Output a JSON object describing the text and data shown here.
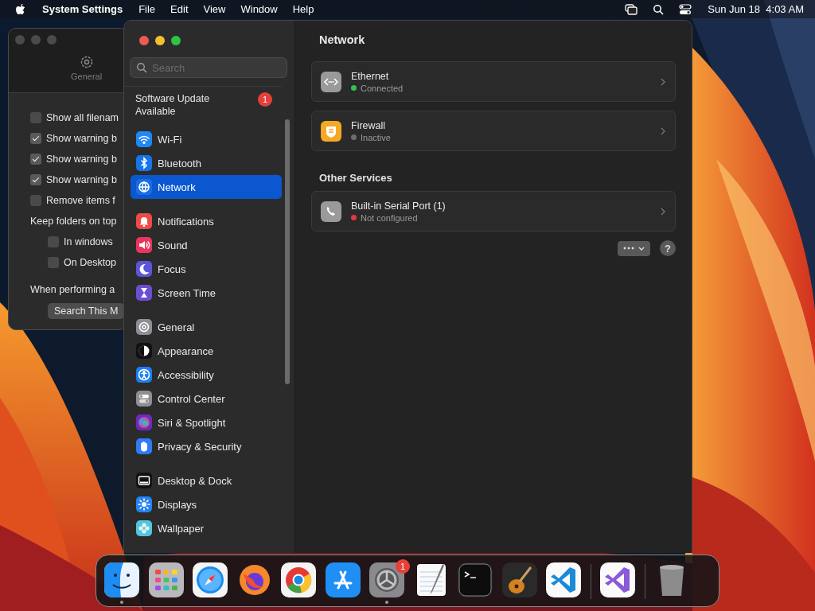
{
  "menu_bar": {
    "app_name": "System Settings",
    "menus": [
      "File",
      "Edit",
      "View",
      "Window",
      "Help"
    ],
    "clock": "Sun Jun 18  4:03 AM"
  },
  "finder_settings_window": {
    "toolbar_tab": "General",
    "options": [
      {
        "kind": "checkbox",
        "label": "Show all filenam",
        "checked": false
      },
      {
        "kind": "checkbox",
        "label": "Show warning b",
        "checked": true
      },
      {
        "kind": "checkbox",
        "label": "Show warning b",
        "checked": true
      },
      {
        "kind": "checkbox",
        "label": "Show warning b",
        "checked": true
      },
      {
        "kind": "checkbox",
        "label": "Remove items f",
        "checked": false
      },
      {
        "kind": "heading",
        "label": "Keep folders on top",
        "children": [
          {
            "kind": "checkbox",
            "label": "In windows",
            "checked": false
          },
          {
            "kind": "checkbox",
            "label": "On Desktop",
            "checked": false
          }
        ]
      },
      {
        "kind": "heading",
        "label": "When performing a"
      }
    ],
    "button": "Search This M"
  },
  "settings_window": {
    "search": {
      "placeholder": "Search"
    },
    "update_notice": {
      "text": "Software Update Available",
      "badge": "1"
    },
    "sidebar_groups": [
      [
        {
          "label": "Wi-Fi",
          "color": "#1e88f5",
          "selected": false
        },
        {
          "label": "Bluetooth",
          "color": "#1476ea",
          "selected": false
        },
        {
          "label": "Network",
          "color": "#1a6fe0",
          "selected": true
        }
      ],
      [
        {
          "label": "Notifications",
          "color": "#ee4a47",
          "selected": false
        },
        {
          "label": "Sound",
          "color": "#e8365d",
          "selected": false
        },
        {
          "label": "Focus",
          "color": "#5b55d8",
          "selected": false
        },
        {
          "label": "Screen Time",
          "color": "#6a4fd3",
          "selected": false
        }
      ],
      [
        {
          "label": "General",
          "color": "#8e8e93",
          "selected": false
        },
        {
          "label": "Appearance",
          "color": "#111111",
          "selected": false
        },
        {
          "label": "Accessibility",
          "color": "#1b7ef0",
          "selected": false
        },
        {
          "label": "Control Center",
          "color": "#8e8e93",
          "selected": false
        },
        {
          "label": "Siri & Spotlight",
          "color": "#6a2dbb",
          "selected": false
        },
        {
          "label": "Privacy & Security",
          "color": "#2f7cf6",
          "selected": false
        }
      ],
      [
        {
          "label": "Desktop & Dock",
          "color": "#111111",
          "selected": false
        },
        {
          "label": "Displays",
          "color": "#2483f0",
          "selected": false
        },
        {
          "label": "Wallpaper",
          "color": "#4fc7dc",
          "selected": false
        }
      ]
    ],
    "title": "Network",
    "services": [
      {
        "name": "Ethernet",
        "status": "Connected",
        "color": "#30c24a"
      },
      {
        "name": "Firewall",
        "status": "Inactive",
        "color": "#6e6e6e"
      }
    ],
    "other_services_heading": "Other Services",
    "other_services": [
      {
        "name": "Built-in Serial Port (1)",
        "status": "Not configured",
        "color": "#e5383b"
      }
    ],
    "help_button": "?"
  },
  "dock": {
    "items": [
      {
        "kind": "app",
        "running": true
      },
      {
        "kind": "app",
        "running": false
      },
      {
        "kind": "app",
        "running": false
      },
      {
        "kind": "app",
        "running": false
      },
      {
        "kind": "app",
        "running": false
      },
      {
        "kind": "app",
        "running": false
      },
      {
        "kind": "app",
        "running": true,
        "badge": "1"
      },
      {
        "kind": "app",
        "running": false
      },
      {
        "kind": "app",
        "running": false
      },
      {
        "kind": "app",
        "running": false
      },
      {
        "kind": "app",
        "running": false
      },
      {
        "kind": "separator"
      },
      {
        "kind": "app",
        "running": false
      },
      {
        "kind": "separator"
      },
      {
        "kind": "app",
        "running": false
      }
    ]
  }
}
